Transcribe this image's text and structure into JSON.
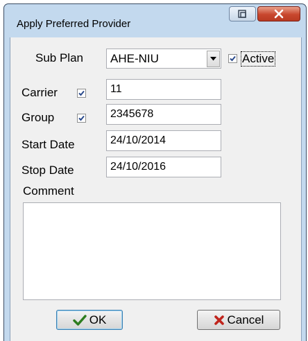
{
  "window": {
    "title": "Apply Preferred Provider"
  },
  "form": {
    "sub_plan": {
      "label": "Sub Plan",
      "value": "AHE-NIU"
    },
    "active": {
      "label": "Active",
      "checked": true
    },
    "carrier": {
      "label": "Carrier",
      "checked": true,
      "value": "11"
    },
    "group": {
      "label": "Group",
      "checked": true,
      "value": "2345678"
    },
    "start_date": {
      "label": "Start Date",
      "value": "24/10/2014"
    },
    "stop_date": {
      "label": "Stop Date",
      "value": "24/10/2016"
    },
    "comment": {
      "label": "Comment",
      "value": ""
    }
  },
  "buttons": {
    "ok": "OK",
    "cancel": "Cancel"
  },
  "icons": {
    "ok": "checkmark-icon",
    "cancel": "x-icon",
    "restore": "restore-icon",
    "close": "close-icon",
    "dropdown": "dropdown-arrow-icon"
  },
  "colors": {
    "ok_check": "#2c7d1f",
    "cancel_x": "#c0241c",
    "checkbox_mark": "#2a4a8c"
  }
}
